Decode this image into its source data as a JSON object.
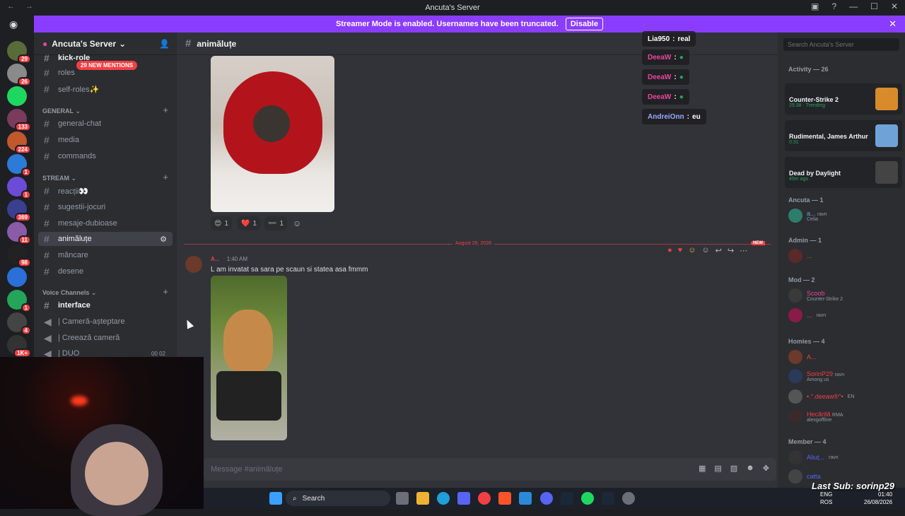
{
  "window": {
    "title": "Ancuta's Server"
  },
  "banner": {
    "text": "Streamer Mode is enabled. Usernames have been truncated.",
    "button": "Disable"
  },
  "guilds": [
    {
      "badge": "29",
      "color": "#5a6b3a"
    },
    {
      "badge": "26",
      "color": "#8a8a8a"
    },
    {
      "badge": "",
      "color": "#1ed760"
    },
    {
      "badge": "133",
      "color": "#7a3b5c"
    },
    {
      "badge": "224",
      "color": "#c0582e"
    },
    {
      "badge": "1",
      "color": "#2c7bd6"
    },
    {
      "badge": "1",
      "color": "#6c4bd8"
    },
    {
      "badge": "369",
      "color": "#3b3f8f"
    },
    {
      "badge": "11",
      "color": "#8a5ca8"
    },
    {
      "badge": "98",
      "color": "#222"
    },
    {
      "badge": "",
      "color": "#2b6fd8"
    },
    {
      "badge": "1",
      "color": "#23a55a"
    },
    {
      "badge": "4",
      "color": "#444"
    },
    {
      "badge": "1K+",
      "color": "#333"
    }
  ],
  "sidebar": {
    "server_name": "Ancuta's Server",
    "mention_pill": "29 NEW MENTIONS",
    "top_channels": [
      "kick-role",
      "roles",
      "self-roles✨"
    ],
    "categories": [
      {
        "label": "GENERAL",
        "channels": [
          "general-chat",
          "media",
          "commands"
        ]
      },
      {
        "label": "STREAM",
        "channels": [
          "reacții👀",
          "sugestii-jocuri",
          "mesaje-dubioase",
          "animăluțe",
          "mâncare",
          "desene"
        ]
      },
      {
        "label": "Voice Channels",
        "channels": [
          "interface",
          "| Cameră-așteptare",
          "| Creează cameră",
          "| DUO"
        ]
      }
    ],
    "duo_counts": "00   02"
  },
  "channel": {
    "name": "animăluțe",
    "composer_placeholder": "Message #animăluțe"
  },
  "reactions": [
    {
      "emoji": "😍",
      "count": "1"
    },
    {
      "emoji": "❤️",
      "count": "1"
    },
    {
      "emoji": "➖",
      "count": "1"
    }
  ],
  "divider": {
    "date": "August 26, 2026",
    "tag": "NEW"
  },
  "message": {
    "author": "A...",
    "time": "1:40 AM",
    "text": "L am invatat sa sara pe scaun si statea asa fmmm"
  },
  "overlay": [
    {
      "name": "Lia950",
      "text": "real",
      "style": "plain"
    },
    {
      "name": "DeeaW",
      "text": "",
      "style": "n1"
    },
    {
      "name": "DeeaW",
      "text": "",
      "style": "n1"
    },
    {
      "name": "DeeaW",
      "text": "",
      "style": "n1"
    },
    {
      "name": "AndreiOnn",
      "text": "eu",
      "style": "n2"
    }
  ],
  "search": {
    "placeholder": "Search Ancuta's Server"
  },
  "members": {
    "activity_header": "Activity — 26",
    "activities": [
      {
        "title": "Counter-Strike 2",
        "sub": "25:38 · Trending",
        "thumb": "#d98a2b"
      },
      {
        "title": "Rudimental, James Arthur",
        "sub": "0:31",
        "thumb": "#6fa3d8"
      },
      {
        "title": "Dead by Daylight",
        "sub": "45m ago",
        "thumb": "#444"
      }
    ],
    "groups": [
      {
        "label": "Ancuta — 1",
        "members": [
          {
            "name": "a...",
            "sub": "Celia",
            "color": "#6fa3d8",
            "tag": "ravn"
          }
        ]
      },
      {
        "label": "Admin — 1",
        "members": [
          {
            "name": "...",
            "sub": "",
            "color": "#f23f43",
            "tag": ""
          }
        ]
      },
      {
        "label": "Mod — 2",
        "members": [
          {
            "name": "Scoob",
            "sub": "Counter-Strike 2",
            "color": "#eb459e",
            "tag": ""
          },
          {
            "name": "...",
            "sub": "",
            "color": "#eb459e",
            "tag": "ravn"
          }
        ]
      },
      {
        "label": "Homies — 4",
        "members": [
          {
            "name": "A...",
            "sub": "",
            "color": "#f23f43",
            "tag": ""
          },
          {
            "name": "SorinP29",
            "sub": "Among us",
            "color": "#f23f43",
            "tag": "ravn"
          },
          {
            "name": "•.°.deeaw®°•",
            "sub": "",
            "color": "#f23f43",
            "tag": "EN"
          },
          {
            "name": "Hecărită",
            "sub": "alexgoffline",
            "color": "#f23f43",
            "tag": "RMA"
          }
        ]
      },
      {
        "label": "Member — 4",
        "members": [
          {
            "name": "Aliuț...",
            "sub": "",
            "color": "#5865f2",
            "tag": "ravn"
          },
          {
            "name": "catta",
            "sub": "",
            "color": "#5865f2",
            "tag": ""
          }
        ]
      }
    ]
  },
  "taskbar": {
    "search": "Search",
    "lang": "ENG\nROS",
    "time": "01:40",
    "date": "26/08/2026"
  },
  "stream_overlay": {
    "last_sub": "Last Sub: sorinp29"
  }
}
